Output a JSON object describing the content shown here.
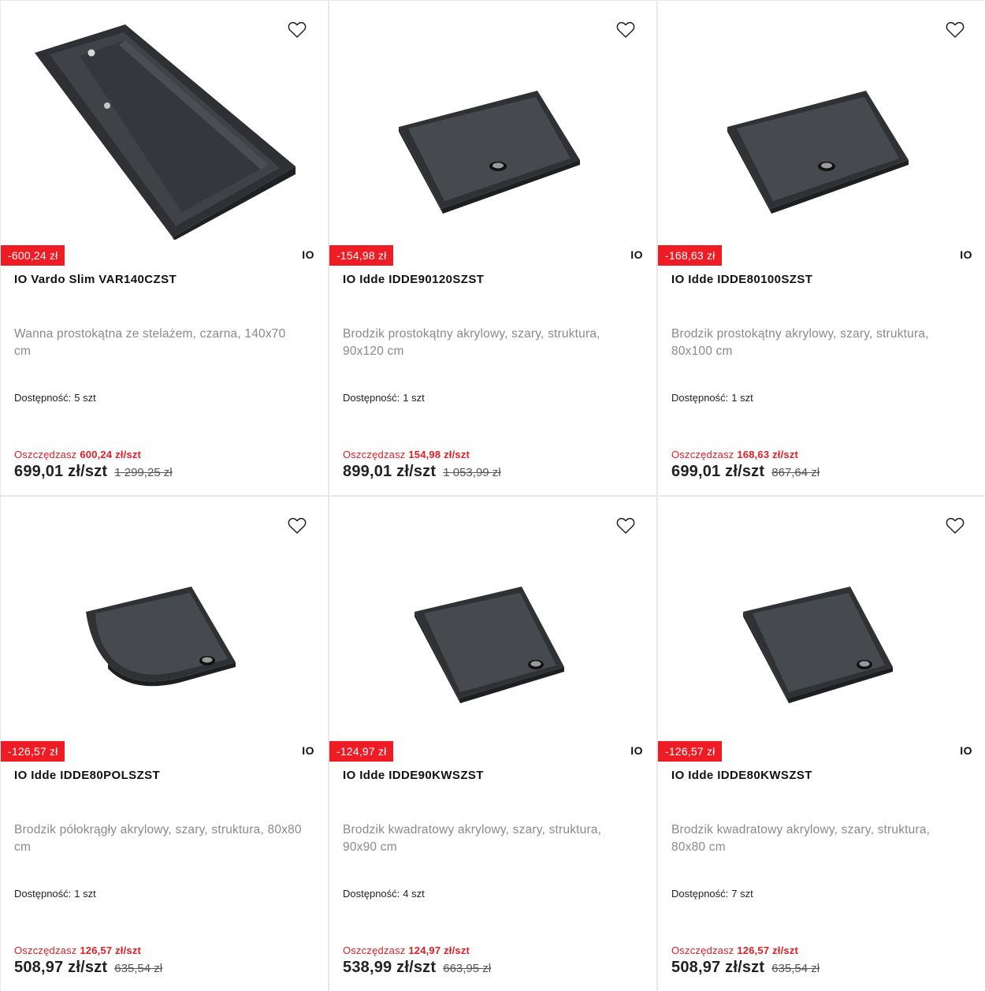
{
  "colors": {
    "discount_bg": "#ee1c25",
    "save_text": "#e31e24",
    "product_dark": "#3a3c40"
  },
  "products": [
    {
      "image": "bathtub-rectangular",
      "discount": "-600,24 zł",
      "brand": "IO",
      "title": "IO Vardo Slim VAR140CZST",
      "description": "Wanna prostokątna ze stelażem, czarna, 140x70 cm",
      "availability_label": "Dostępność:",
      "availability_value": "5 szt",
      "save_label": "Oszczędzasz",
      "save_value": "600,24 zł/szt",
      "price": "699,01 zł/szt",
      "old_price": "1 299,25 zł"
    },
    {
      "image": "shower-tray-rectangular",
      "discount": "-154,98 zł",
      "brand": "IO",
      "title": "IO Idde IDDE90120SZST",
      "description": "Brodzik prostokątny akrylowy, szary, struktura, 90x120 cm",
      "availability_label": "Dostępność:",
      "availability_value": "1 szt",
      "save_label": "Oszczędzasz",
      "save_value": "154,98 zł/szt",
      "price": "899,01 zł/szt",
      "old_price": "1 053,99 zł"
    },
    {
      "image": "shower-tray-rectangular",
      "discount": "-168,63 zł",
      "brand": "IO",
      "title": "IO Idde IDDE80100SZST",
      "description": "Brodzik prostokątny akrylowy, szary, struktura, 80x100 cm",
      "availability_label": "Dostępność:",
      "availability_value": "1 szt",
      "save_label": "Oszczędzasz",
      "save_value": "168,63 zł/szt",
      "price": "699,01 zł/szt",
      "old_price": "867,64 zł"
    },
    {
      "image": "shower-tray-half-round",
      "discount": "-126,57 zł",
      "brand": "IO",
      "title": "IO Idde IDDE80POLSZST",
      "description": "Brodzik półokrągły akrylowy, szary, struktura, 80x80 cm",
      "availability_label": "Dostępność:",
      "availability_value": "1 szt",
      "save_label": "Oszczędzasz",
      "save_value": "126,57 zł/szt",
      "price": "508,97 zł/szt",
      "old_price": "635,54 zł"
    },
    {
      "image": "shower-tray-square",
      "discount": "-124,97 zł",
      "brand": "IO",
      "title": "IO Idde IDDE90KWSZST",
      "description": "Brodzik kwadratowy akrylowy, szary, struktura, 90x90 cm",
      "availability_label": "Dostępność:",
      "availability_value": "4 szt",
      "save_label": "Oszczędzasz",
      "save_value": "124,97 zł/szt",
      "price": "538,99 zł/szt",
      "old_price": "663,95 zł"
    },
    {
      "image": "shower-tray-square",
      "discount": "-126,57 zł",
      "brand": "IO",
      "title": "IO Idde IDDE80KWSZST",
      "description": "Brodzik kwadratowy akrylowy, szary, struktura, 80x80 cm",
      "availability_label": "Dostępność:",
      "availability_value": "7 szt",
      "save_label": "Oszczędzasz",
      "save_value": "126,57 zł/szt",
      "price": "508,97 zł/szt",
      "old_price": "635,54 zł"
    }
  ]
}
